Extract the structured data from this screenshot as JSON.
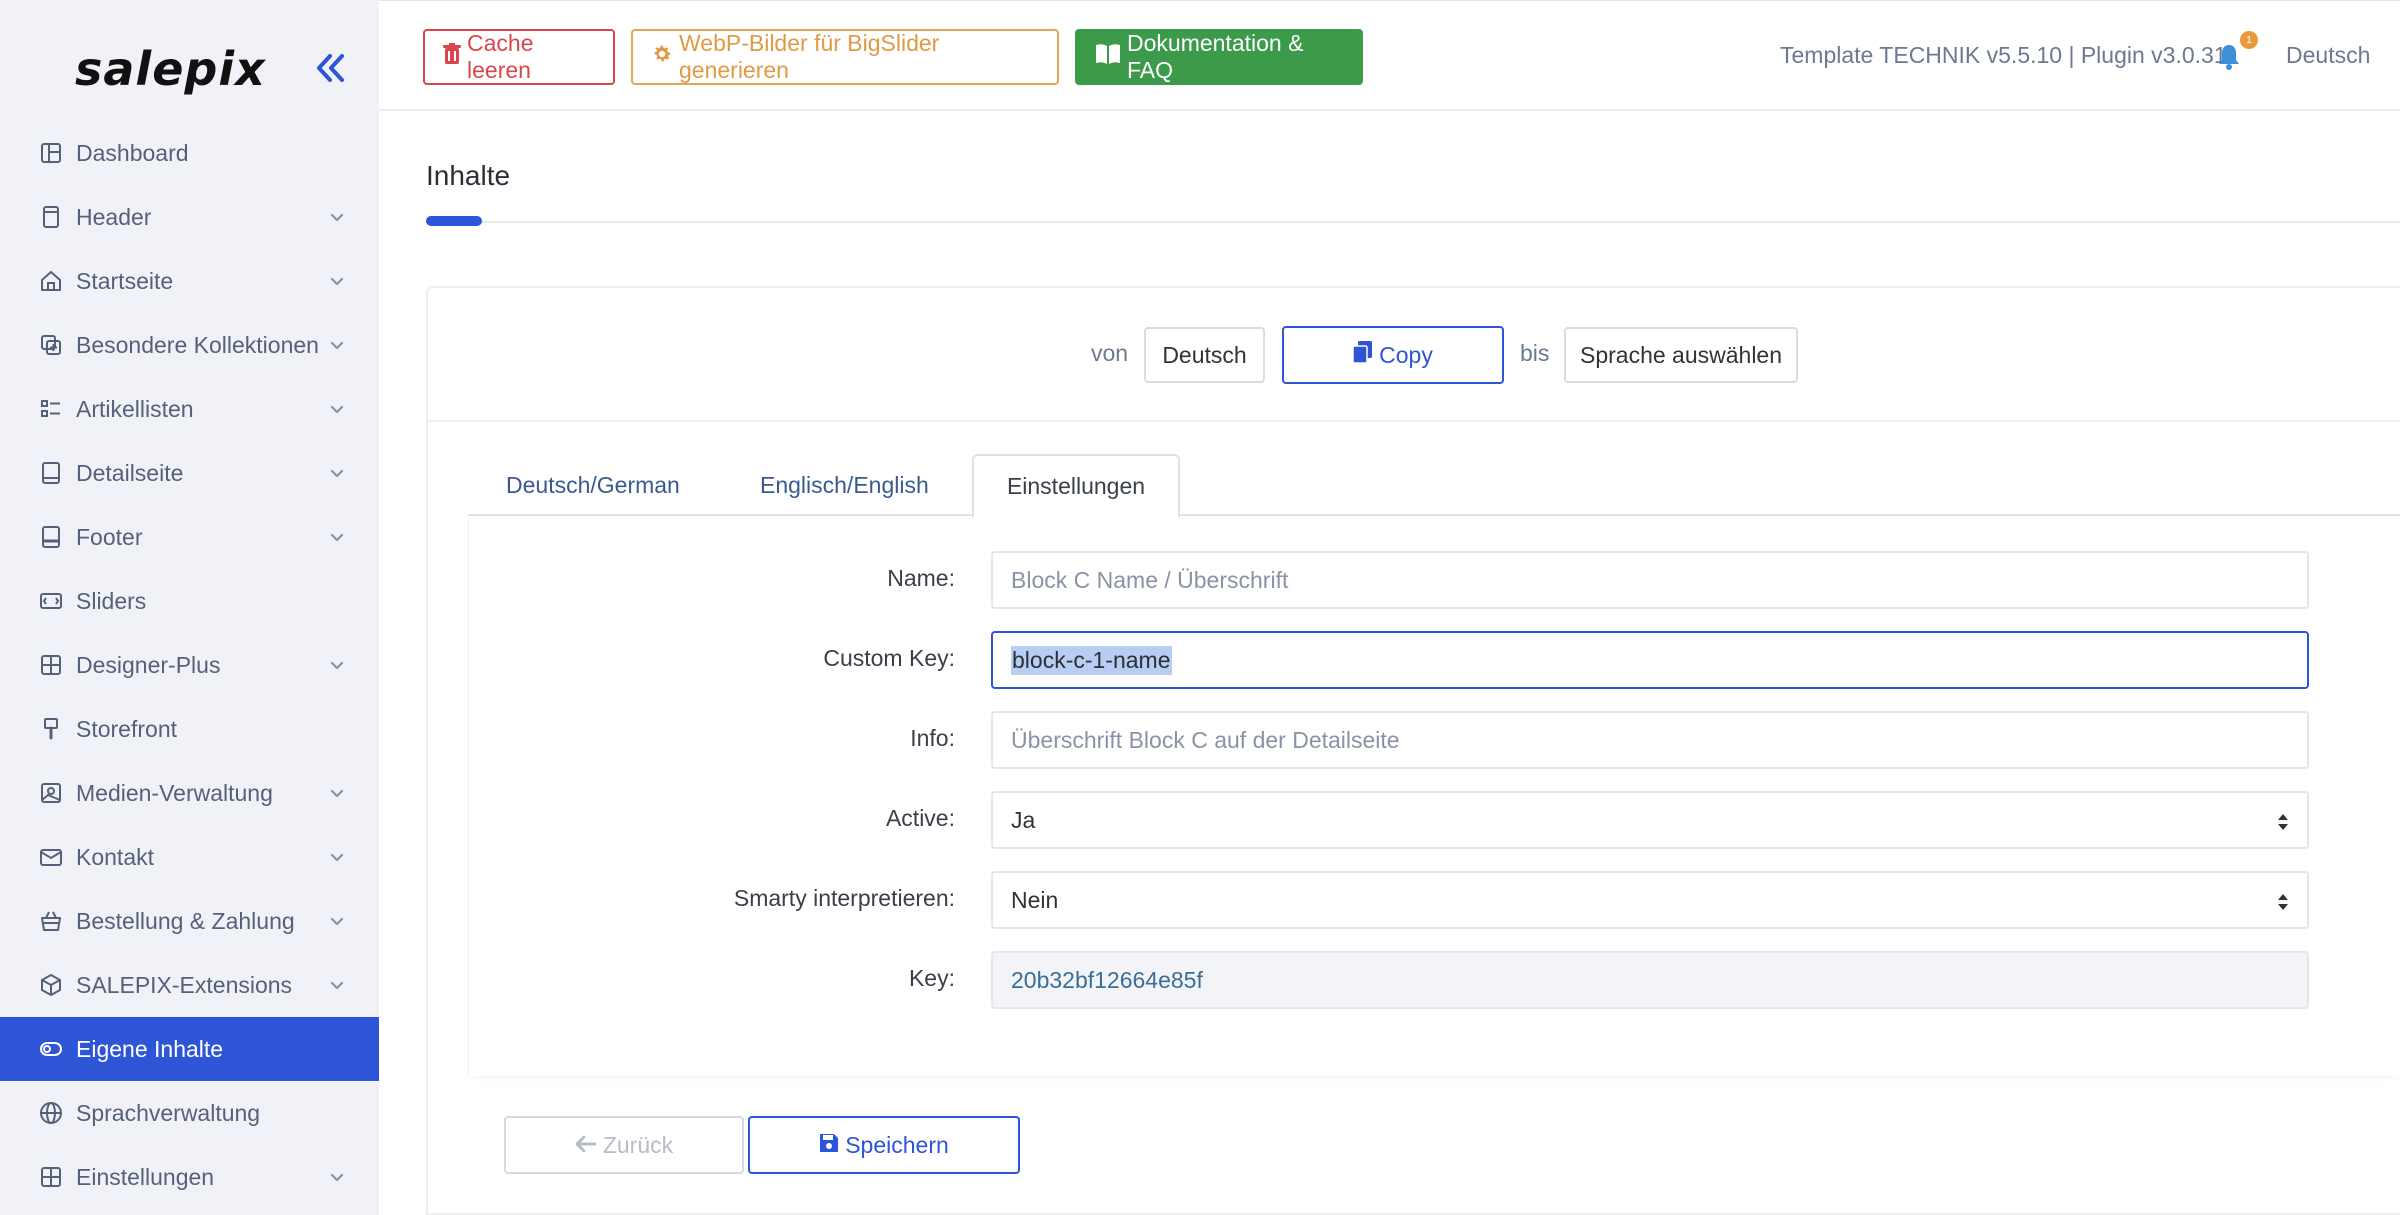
{
  "brand": {
    "logo_text": "salepix"
  },
  "sidebar": {
    "items": [
      {
        "label": "Dashboard",
        "icon": "dashboard-icon",
        "has_chevron": false
      },
      {
        "label": "Header",
        "icon": "header-icon",
        "has_chevron": true
      },
      {
        "label": "Startseite",
        "icon": "home-icon",
        "has_chevron": true
      },
      {
        "label": "Besondere Kollektionen",
        "icon": "collections-icon",
        "has_chevron": true
      },
      {
        "label": "Artikellisten",
        "icon": "list-icon",
        "has_chevron": true
      },
      {
        "label": "Detailseite",
        "icon": "detail-page-icon",
        "has_chevron": true
      },
      {
        "label": "Footer",
        "icon": "footer-icon",
        "has_chevron": true
      },
      {
        "label": "Sliders",
        "icon": "slider-icon",
        "has_chevron": false
      },
      {
        "label": "Designer-Plus",
        "icon": "designer-icon",
        "has_chevron": true
      },
      {
        "label": "Storefront",
        "icon": "brush-icon",
        "has_chevron": false
      },
      {
        "label": "Medien-Verwaltung",
        "icon": "media-icon",
        "has_chevron": true
      },
      {
        "label": "Kontakt",
        "icon": "mail-icon",
        "has_chevron": true
      },
      {
        "label": "Bestellung & Zahlung",
        "icon": "basket-icon",
        "has_chevron": true
      },
      {
        "label": "SALEPIX-Extensions",
        "icon": "package-icon",
        "has_chevron": true
      },
      {
        "label": "Eigene Inhalte",
        "icon": "toggle-icon",
        "has_chevron": false,
        "active": true
      },
      {
        "label": "Sprachverwaltung",
        "icon": "globe-icon",
        "has_chevron": false
      },
      {
        "label": "Einstellungen",
        "icon": "settings-grid-icon",
        "has_chevron": true
      }
    ]
  },
  "topbar": {
    "cache_label": "Cache leeren",
    "webp_label": "WebP-Bilder für BigSlider generieren",
    "doc_label": "Dokumentation & FAQ",
    "version_text": "Template TECHNIK v5.5.10 | Plugin v3.0.31",
    "notification_count": "1",
    "language": "Deutsch"
  },
  "page": {
    "title": "Inhalte"
  },
  "copy_bar": {
    "von_label": "von",
    "from_value": "Deutsch",
    "copy_label": "Copy",
    "bis_label": "bis",
    "to_value": "Sprache auswählen"
  },
  "tabs": [
    {
      "label": "Deutsch/German",
      "active": false
    },
    {
      "label": "Englisch/English",
      "active": false
    },
    {
      "label": "Einstellungen",
      "active": true
    }
  ],
  "form": {
    "name": {
      "label": "Name:",
      "placeholder": "Block C Name / Überschrift"
    },
    "custom_key": {
      "label": "Custom Key:",
      "value": "block-c-1-name"
    },
    "info": {
      "label": "Info:",
      "placeholder": "Überschrift Block C auf der Detailseite"
    },
    "active": {
      "label": "Active:",
      "value": "Ja"
    },
    "smarty": {
      "label": "Smarty interpretieren:",
      "value": "Nein"
    },
    "key": {
      "label": "Key:",
      "value": "20b32bf12664e85f"
    }
  },
  "actions": {
    "back_label": "Zurück",
    "save_label": "Speichern"
  },
  "colors": {
    "accent": "#2e55d6",
    "sidebar_bg": "#f1f2f8",
    "danger": "#d9464e",
    "warning": "#e09a45",
    "success": "#3c9a4b"
  }
}
